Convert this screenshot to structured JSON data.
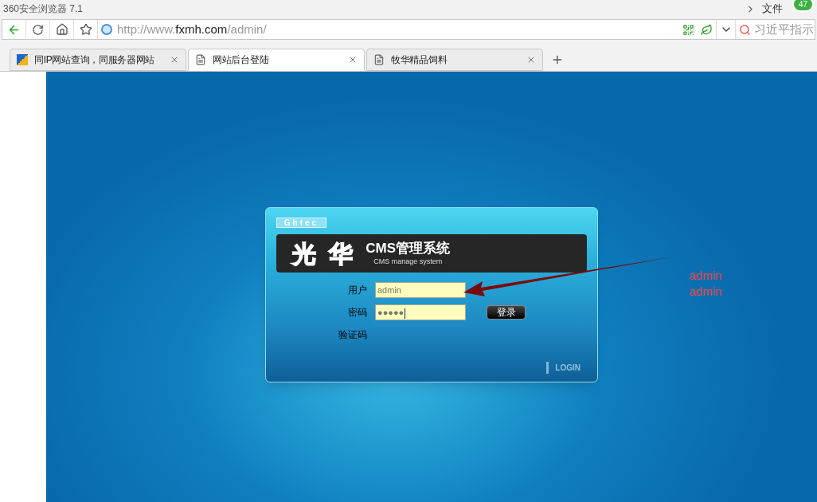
{
  "window": {
    "title": "360安全浏览器 7.1",
    "menu": "文件",
    "badge": "47"
  },
  "address_bar": {
    "url_prefix": "http://www.",
    "url_domain": "fxmh.com",
    "url_path": "/admin/",
    "search_placeholder": "习近平指示"
  },
  "tabs": [
    {
      "label": "同IP网站查询，同服务器网站",
      "selected": false,
      "kind": "site"
    },
    {
      "label": "网站后台登陆",
      "selected": true,
      "kind": "page"
    },
    {
      "label": "牧华精品饲料",
      "selected": false,
      "kind": "page"
    }
  ],
  "login": {
    "brand": "Ghtec",
    "logo": "光 华",
    "title": "CMS管理系统",
    "subtitle": "CMS manage system",
    "fields": [
      {
        "label": "用户",
        "value": "admin"
      },
      {
        "label": "密码",
        "value": "●●●●●"
      },
      {
        "label": "验证码"
      }
    ],
    "submit": "登录",
    "footer": "LOGIN"
  },
  "annotation": [
    "admin",
    "admin"
  ]
}
